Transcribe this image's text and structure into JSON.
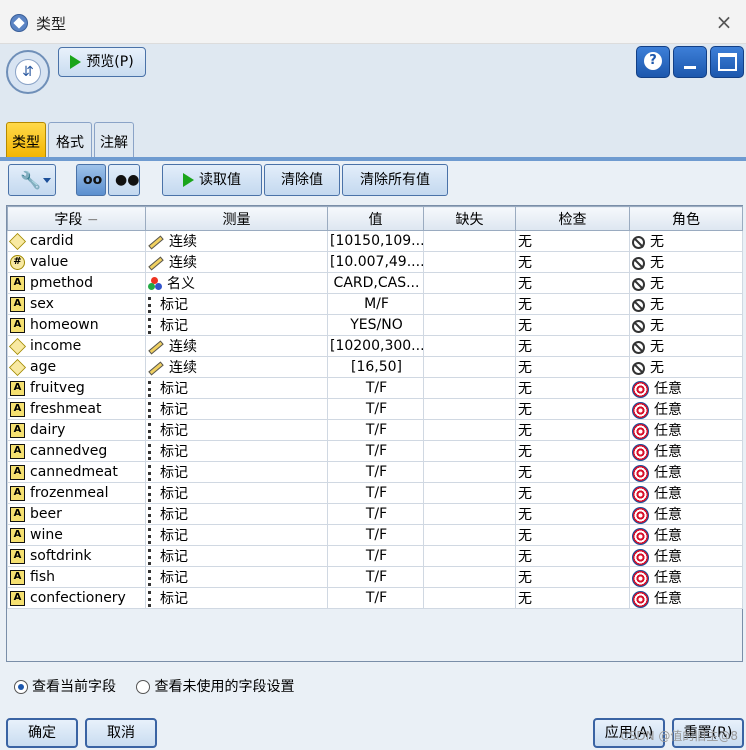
{
  "window": {
    "title": "类型",
    "close_label": "×"
  },
  "header": {
    "preview_label": "预览(P)",
    "help_label": "?"
  },
  "tabs": [
    {
      "label": "类型"
    },
    {
      "label": "格式"
    },
    {
      "label": "注解"
    }
  ],
  "toolbar": {
    "read_label": "读取值",
    "clear_label": "清除值",
    "clear_all_label": "清除所有值"
  },
  "table": {
    "columns": [
      "字段",
      "测量",
      "值",
      "缺失",
      "检查",
      "角色"
    ],
    "rows": [
      {
        "field": "cardid",
        "field_icon": "continuous-field-icon",
        "measure": "连续",
        "measure_icon": "ruler-icon",
        "value": "[10150,109...",
        "missing": "",
        "check": "无",
        "role": "无",
        "role_icon": "none-icon"
      },
      {
        "field": "value",
        "field_icon": "numeric-field-icon",
        "measure": "连续",
        "measure_icon": "ruler-icon",
        "value": "[10.007,49....",
        "missing": "",
        "check": "无",
        "role": "无",
        "role_icon": "none-icon"
      },
      {
        "field": "pmethod",
        "field_icon": "string-field-icon",
        "measure": "名义",
        "measure_icon": "nominal-icon",
        "value": "CARD,CAS...",
        "missing": "",
        "check": "无",
        "role": "无",
        "role_icon": "none-icon"
      },
      {
        "field": "sex",
        "field_icon": "string-field-icon",
        "measure": "标记",
        "measure_icon": "flag-icon",
        "value": "M/F",
        "missing": "",
        "check": "无",
        "role": "无",
        "role_icon": "none-icon"
      },
      {
        "field": "homeown",
        "field_icon": "string-field-icon",
        "measure": "标记",
        "measure_icon": "flag-icon",
        "value": "YES/NO",
        "missing": "",
        "check": "无",
        "role": "无",
        "role_icon": "none-icon"
      },
      {
        "field": "income",
        "field_icon": "continuous-field-icon",
        "measure": "连续",
        "measure_icon": "ruler-icon",
        "value": "[10200,300...",
        "missing": "",
        "check": "无",
        "role": "无",
        "role_icon": "none-icon"
      },
      {
        "field": "age",
        "field_icon": "continuous-field-icon",
        "measure": "连续",
        "measure_icon": "ruler-icon",
        "value": "[16,50]",
        "missing": "",
        "check": "无",
        "role": "无",
        "role_icon": "none-icon"
      },
      {
        "field": "fruitveg",
        "field_icon": "string-field-icon",
        "measure": "标记",
        "measure_icon": "flag-icon",
        "value": "T/F",
        "missing": "",
        "check": "无",
        "role": "任意",
        "role_icon": "target-icon"
      },
      {
        "field": "freshmeat",
        "field_icon": "string-field-icon",
        "measure": "标记",
        "measure_icon": "flag-icon",
        "value": "T/F",
        "missing": "",
        "check": "无",
        "role": "任意",
        "role_icon": "target-icon"
      },
      {
        "field": "dairy",
        "field_icon": "string-field-icon",
        "measure": "标记",
        "measure_icon": "flag-icon",
        "value": "T/F",
        "missing": "",
        "check": "无",
        "role": "任意",
        "role_icon": "target-icon"
      },
      {
        "field": "cannedveg",
        "field_icon": "string-field-icon",
        "measure": "标记",
        "measure_icon": "flag-icon",
        "value": "T/F",
        "missing": "",
        "check": "无",
        "role": "任意",
        "role_icon": "target-icon"
      },
      {
        "field": "cannedmeat",
        "field_icon": "string-field-icon",
        "measure": "标记",
        "measure_icon": "flag-icon",
        "value": "T/F",
        "missing": "",
        "check": "无",
        "role": "任意",
        "role_icon": "target-icon"
      },
      {
        "field": "frozenmeal",
        "field_icon": "string-field-icon",
        "measure": "标记",
        "measure_icon": "flag-icon",
        "value": "T/F",
        "missing": "",
        "check": "无",
        "role": "任意",
        "role_icon": "target-icon"
      },
      {
        "field": "beer",
        "field_icon": "string-field-icon",
        "measure": "标记",
        "measure_icon": "flag-icon",
        "value": "T/F",
        "missing": "",
        "check": "无",
        "role": "任意",
        "role_icon": "target-icon"
      },
      {
        "field": "wine",
        "field_icon": "string-field-icon",
        "measure": "标记",
        "measure_icon": "flag-icon",
        "value": "T/F",
        "missing": "",
        "check": "无",
        "role": "任意",
        "role_icon": "target-icon"
      },
      {
        "field": "softdrink",
        "field_icon": "string-field-icon",
        "measure": "标记",
        "measure_icon": "flag-icon",
        "value": "T/F",
        "missing": "",
        "check": "无",
        "role": "任意",
        "role_icon": "target-icon"
      },
      {
        "field": "fish",
        "field_icon": "string-field-icon",
        "measure": "标记",
        "measure_icon": "flag-icon",
        "value": "T/F",
        "missing": "",
        "check": "无",
        "role": "任意",
        "role_icon": "target-icon"
      },
      {
        "field": "confectionery",
        "field_icon": "string-field-icon",
        "measure": "标记",
        "measure_icon": "flag-icon",
        "value": "T/F",
        "missing": "",
        "check": "无",
        "role": "任意",
        "role_icon": "target-icon"
      }
    ]
  },
  "options": {
    "current_label": "查看当前字段",
    "unused_label": "查看未使用的字段设置",
    "selected": "current"
  },
  "footer": {
    "ok_label": "确定",
    "cancel_label": "取消",
    "apply_label": "应用(A)",
    "reset_label": "重置(R)"
  },
  "watermark": "CSDN @值的旧主@8"
}
